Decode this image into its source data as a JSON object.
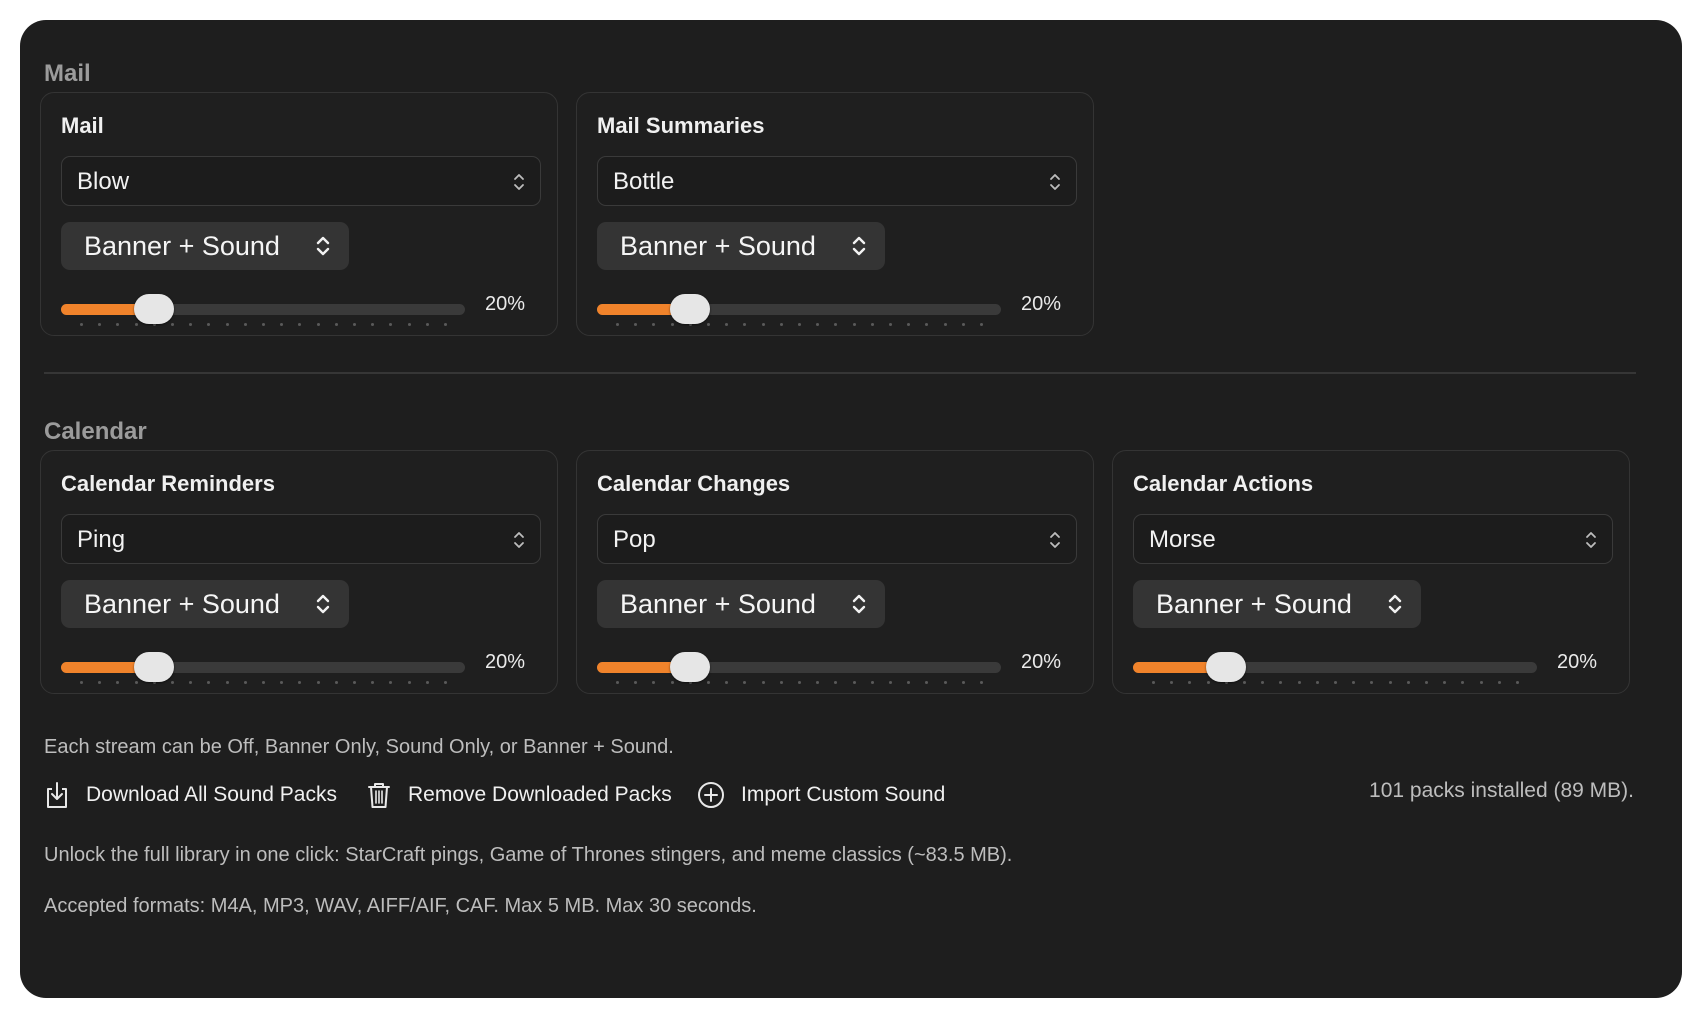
{
  "sections": {
    "mail": {
      "title": "Mail"
    },
    "calendar": {
      "title": "Calendar"
    }
  },
  "cards": [
    {
      "title": "Mail",
      "sound": "Blow",
      "mode": "Banner + Sound",
      "volume_label": "20%",
      "volume": 0.2
    },
    {
      "title": "Mail Summaries",
      "sound": "Bottle",
      "mode": "Banner + Sound",
      "volume_label": "20%",
      "volume": 0.2
    },
    {
      "title": "Calendar Reminders",
      "sound": "Ping",
      "mode": "Banner + Sound",
      "volume_label": "20%",
      "volume": 0.2
    },
    {
      "title": "Calendar Changes",
      "sound": "Pop",
      "mode": "Banner + Sound",
      "volume_label": "20%",
      "volume": 0.2
    },
    {
      "title": "Calendar Actions",
      "sound": "Morse",
      "mode": "Banner + Sound",
      "volume_label": "20%",
      "volume": 0.2
    }
  ],
  "footer": {
    "stream_note": "Each stream can be Off, Banner Only, Sound Only, or Banner + Sound.",
    "download_all": "Download All Sound Packs",
    "remove_downloaded": "Remove Downloaded Packs",
    "import_custom": "Import Custom Sound",
    "installed_status": "101 packs installed (89 MB).",
    "unlock_note": "Unlock the full library in one click: StarCraft pings, Game of Thrones stingers, and meme classics (~83.5 MB).",
    "formats_note": "Accepted formats: M4A, MP3, WAV, AIFF/AIF, CAF. Max 5 MB. Max 30 seconds."
  },
  "colors": {
    "accent": "#f0832b",
    "background": "#1e1e1e",
    "card_border": "#343434"
  },
  "icons": {
    "download": "download-tray-icon",
    "trash": "trash-icon",
    "import": "plus-circle-icon",
    "chevron": "up-down-chevron-icon"
  }
}
